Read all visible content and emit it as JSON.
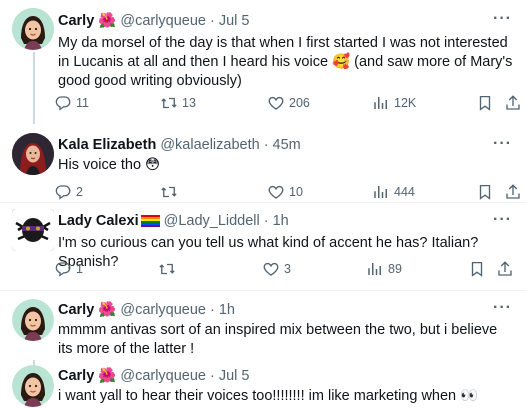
{
  "tweets": [
    {
      "name": "Carly",
      "handle": "@carlyqueue",
      "sep": "·",
      "time": "Jul 5",
      "emoji": "🌺",
      "text": "My da morsel of the day is that when I first started I was not interested in Lucanis at all and then I heard his voice 🥰 (and saw more of Mary's good good writing obviously)",
      "replies": "11",
      "retweets": "13",
      "likes": "206",
      "views": "12K"
    },
    {
      "name": "Kala Elizabeth",
      "handle": "@kalaelizabeth",
      "sep": "·",
      "time": "45m",
      "text": "His voice tho 😳",
      "replies": "2",
      "retweets": "",
      "likes": "10",
      "views": "444"
    },
    {
      "name": "Lady Calexi",
      "handle": "@Lady_Liddell",
      "sep": "·",
      "time": "1h",
      "text": "I'm so curious can you tell us what kind of accent he has? Italian? Spanish?",
      "replies": "1",
      "retweets": "",
      "likes": "3",
      "views": "89"
    },
    {
      "name": "Carly",
      "handle": "@carlyqueue",
      "sep": "·",
      "time": "1h",
      "emoji": "🌺",
      "text": "mmmm antivas sort of an inspired mix between the two, but i believe its more of the latter !"
    },
    {
      "name": "Carly",
      "handle": "@carlyqueue",
      "sep": "·",
      "time": "Jul 5",
      "emoji": "🌺",
      "text": "i want yall to hear their voices too!!!!!!!! im like marketing when 👀"
    }
  ],
  "icons": {
    "reply": "reply-icon",
    "retweet": "retweet-icon",
    "like": "heart-icon",
    "views": "views-icon",
    "bookmark": "bookmark-icon",
    "share": "share-icon",
    "more": "more-icon"
  },
  "more_glyph": "···",
  "colors": {
    "text": "#0f1419",
    "secondary": "#536471",
    "divider": "#eff3f4",
    "thread_line": "#cfd9de"
  }
}
